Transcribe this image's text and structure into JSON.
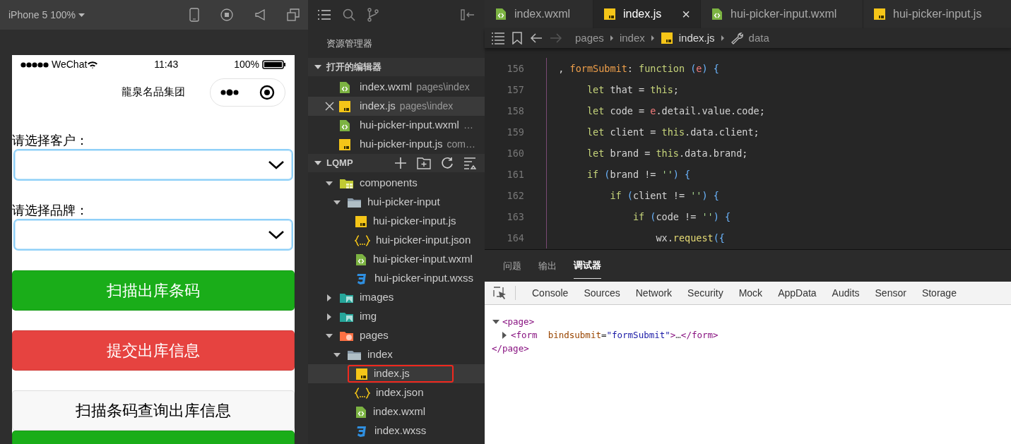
{
  "simulator": {
    "device": "iPhone 5 100%",
    "status_bar": {
      "carrier": "WeChat",
      "time": "11:43",
      "battery": "100%"
    },
    "nav_title": "龍泉名品集团",
    "form": [
      {
        "kind": "picker",
        "label": "请选择客户："
      },
      {
        "kind": "picker",
        "label": "请选择品牌："
      },
      {
        "kind": "button",
        "label": "扫描出库条码",
        "color": "#1aad19"
      },
      {
        "kind": "button",
        "label": "提交出库信息",
        "color": "#e64340"
      },
      {
        "kind": "button",
        "label": "扫描条码查询出库信息",
        "color": "#f8f8f8"
      },
      {
        "kind": "button",
        "color": "#1aad19"
      }
    ]
  },
  "explorer": {
    "title": "资源管理器",
    "open_editors": {
      "title": "打开的编辑器",
      "expanded": true,
      "items": [
        {
          "name": "index.wxml",
          "path": "pages\\index",
          "kind": "wxml",
          "selected": false
        },
        {
          "name": "index.js",
          "path": "pages\\index",
          "kind": "js",
          "selected": true
        },
        {
          "name": "hui-picker-input.wxml",
          "path": "…",
          "kind": "wxml",
          "selected": false
        },
        {
          "name": "hui-picker-input.js",
          "path": "com…",
          "kind": "js",
          "selected": false
        }
      ]
    },
    "project": {
      "title": "LQMP",
      "expanded": true,
      "tree": [
        {
          "name": "components",
          "kind": "components",
          "expanded": true,
          "selected": false,
          "children": [
            {
              "name": "hui-picker-input",
              "kind": "folder",
              "expanded": true,
              "selected": false,
              "children": [
                {
                  "name": "hui-picker-input.js",
                  "kind": "js",
                  "selected": false
                },
                {
                  "name": "hui-picker-input.json",
                  "kind": "json",
                  "selected": false
                },
                {
                  "name": "hui-picker-input.wxml",
                  "kind": "wxml",
                  "selected": false
                },
                {
                  "name": "hui-picker-input.wxss",
                  "kind": "wxss",
                  "selected": false
                }
              ]
            }
          ]
        },
        {
          "name": "images",
          "kind": "images",
          "expanded": false,
          "selected": false
        },
        {
          "name": "img",
          "kind": "images",
          "expanded": false,
          "selected": false
        },
        {
          "name": "pages",
          "kind": "pages",
          "expanded": true,
          "selected": false,
          "children": [
            {
              "name": "index",
              "kind": "folder",
              "expanded": true,
              "selected": false,
              "children": [
                {
                  "name": "index.js",
                  "kind": "js",
                  "selected": true
                },
                {
                  "name": "index.json",
                  "kind": "json",
                  "selected": false
                },
                {
                  "name": "index.wxml",
                  "kind": "wxml",
                  "selected": false
                },
                {
                  "name": "index.wxss",
                  "kind": "wxss",
                  "selected": false
                }
              ]
            }
          ]
        }
      ]
    }
  },
  "editor": {
    "tabs": [
      {
        "name": "index.wxml",
        "kind": "wxml",
        "selected": false
      },
      {
        "name": "index.js",
        "kind": "js",
        "selected": true
      },
      {
        "name": "hui-picker-input.wxml",
        "kind": "wxml",
        "selected": false
      },
      {
        "name": "hui-picker-input.js",
        "kind": "js",
        "selected": false
      }
    ],
    "close_glyph": "×",
    "breadcrumb": [
      {
        "text": "pages",
        "kind": "plain"
      },
      {
        "text": "index",
        "kind": "plain"
      },
      {
        "text": "index.js",
        "kind": "js"
      },
      {
        "text": "data",
        "kind": "property"
      }
    ],
    "lines": [
      {
        "number": "156",
        "tokens": [
          {
            "text": "  , ",
            "kind": "plain"
          },
          {
            "text": "formSubmit",
            "kind": "prop"
          },
          {
            "text": ": ",
            "kind": "plain"
          },
          {
            "text": "function",
            "kind": "kw"
          },
          {
            "text": " (",
            "kind": "punct"
          },
          {
            "text": "e",
            "kind": "param"
          },
          {
            "text": ") {",
            "kind": "punct"
          }
        ]
      },
      {
        "number": "157",
        "tokens": [
          {
            "text": "       let",
            "kind": "kw"
          },
          {
            "text": " that = ",
            "kind": "plain"
          },
          {
            "text": "this",
            "kind": "kw"
          },
          {
            "text": ";",
            "kind": "plain"
          }
        ]
      },
      {
        "number": "158",
        "tokens": [
          {
            "text": "       let",
            "kind": "kw"
          },
          {
            "text": " code = ",
            "kind": "plain"
          },
          {
            "text": "e",
            "kind": "param"
          },
          {
            "text": ".detail.value.code;",
            "kind": "plain"
          }
        ]
      },
      {
        "number": "159",
        "tokens": [
          {
            "text": "       let",
            "kind": "kw"
          },
          {
            "text": " client = ",
            "kind": "plain"
          },
          {
            "text": "this",
            "kind": "kw"
          },
          {
            "text": ".data.client;",
            "kind": "plain"
          }
        ]
      },
      {
        "number": "160",
        "tokens": [
          {
            "text": "       let",
            "kind": "kw"
          },
          {
            "text": " brand = ",
            "kind": "plain"
          },
          {
            "text": "this",
            "kind": "kw"
          },
          {
            "text": ".data.brand;",
            "kind": "plain"
          }
        ]
      },
      {
        "number": "161",
        "tokens": [
          {
            "text": "       if",
            "kind": "kw"
          },
          {
            "text": " (",
            "kind": "punct"
          },
          {
            "text": "brand != ",
            "kind": "plain"
          },
          {
            "text": "''",
            "kind": "str"
          },
          {
            "text": ") {",
            "kind": "punct"
          }
        ]
      },
      {
        "number": "162",
        "tokens": [
          {
            "text": "           if",
            "kind": "kw"
          },
          {
            "text": " (",
            "kind": "punct"
          },
          {
            "text": "client != ",
            "kind": "plain"
          },
          {
            "text": "''",
            "kind": "str"
          },
          {
            "text": ") {",
            "kind": "punct"
          }
        ]
      },
      {
        "number": "163",
        "tokens": [
          {
            "text": "               if",
            "kind": "kw"
          },
          {
            "text": " (",
            "kind": "punct"
          },
          {
            "text": "code != ",
            "kind": "plain"
          },
          {
            "text": "''",
            "kind": "str"
          },
          {
            "text": ") {",
            "kind": "punct"
          }
        ]
      },
      {
        "number": "164",
        "tokens": [
          {
            "text": "                   wx.",
            "kind": "plain"
          },
          {
            "text": "request",
            "kind": "fn"
          },
          {
            "text": "({",
            "kind": "punct"
          }
        ]
      }
    ]
  },
  "panel": {
    "tabs": [
      {
        "label": "问题",
        "selected": false
      },
      {
        "label": "输出",
        "selected": false
      },
      {
        "label": "调试器",
        "selected": true
      }
    ],
    "devtools_tabs": [
      {
        "label": "Console",
        "selected": false
      },
      {
        "label": "Sources",
        "selected": false
      },
      {
        "label": "Network",
        "selected": false
      },
      {
        "label": "Security",
        "selected": false
      },
      {
        "label": "Mock",
        "selected": false
      },
      {
        "label": "AppData",
        "selected": false
      },
      {
        "label": "Audits",
        "selected": false
      },
      {
        "label": "Sensor",
        "selected": false
      },
      {
        "label": "Storage",
        "selected": false
      }
    ],
    "elements": [
      {
        "expanded": true,
        "open": [
          {
            "text": "<page>",
            "kind": "tag"
          }
        ],
        "close": [
          {
            "text": "</page>",
            "kind": "tag"
          }
        ],
        "children": [
          {
            "expanded": false,
            "open": [
              {
                "text": "<form",
                "kind": "tag"
              },
              {
                "text": "  bindsubmit",
                "kind": "attr"
              },
              {
                "text": "=",
                "kind": "plain"
              },
              {
                "text": "\"formSubmit\"",
                "kind": "val"
              },
              {
                "text": ">",
                "kind": "tag"
              },
              {
                "text": "…",
                "kind": "dim"
              },
              {
                "text": "</form>",
                "kind": "tag"
              }
            ]
          }
        ]
      }
    ]
  }
}
